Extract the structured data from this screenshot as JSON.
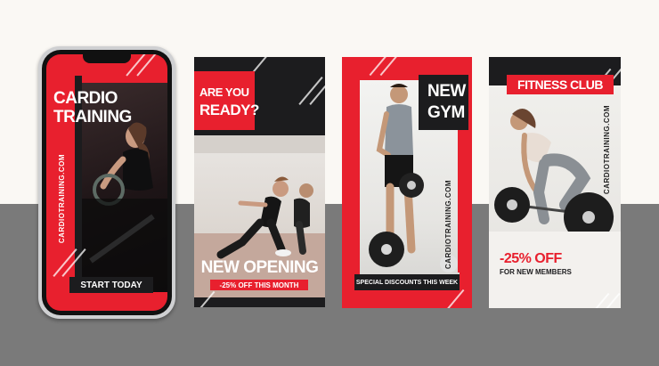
{
  "colors": {
    "red": "#e8202e",
    "dark": "#1c1c1e",
    "wall": "#faf8f4",
    "floor": "#7a7a7a"
  },
  "phone": {
    "title_line1": "CARDIO",
    "title_line2": "TRAINING",
    "website": "CARDIOTRAINING.COM",
    "cta": "START TODAY"
  },
  "story1": {
    "headline_line1": "ARE YOU",
    "headline_line2": "READY?",
    "title": "NEW OPENING",
    "offer": "-25% OFF THIS MONTH"
  },
  "story2": {
    "headline_line1": "NEW",
    "headline_line2": "GYM",
    "website": "CARDIOTRAINING.COM",
    "footer": "SPECIAL DISCOUNTS THIS WEEK"
  },
  "story3": {
    "banner": "FITNESS CLUB",
    "website": "CARDIOTRAINING.COM",
    "discount": "-25% OFF",
    "subtext": "FOR NEW MEMBERS"
  }
}
